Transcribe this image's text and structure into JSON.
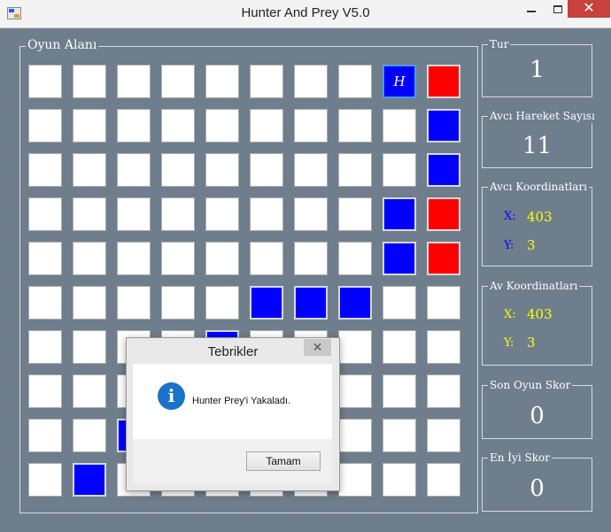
{
  "window": {
    "title": "Hunter And Prey V5.0",
    "close_glyph": "✕"
  },
  "board": {
    "label": "Oyun Alanı",
    "rows": [
      [
        "white",
        "white",
        "white",
        "white",
        "white",
        "white",
        "white",
        "white",
        "hunter",
        "red"
      ],
      [
        "white",
        "white",
        "white",
        "white",
        "white",
        "white",
        "white",
        "white",
        "white",
        "blue"
      ],
      [
        "white",
        "white",
        "white",
        "white",
        "white",
        "white",
        "white",
        "white",
        "white",
        "blue"
      ],
      [
        "white",
        "white",
        "white",
        "white",
        "white",
        "white",
        "white",
        "white",
        "blue",
        "red"
      ],
      [
        "white",
        "white",
        "white",
        "white",
        "white",
        "white",
        "white",
        "white",
        "blue",
        "red"
      ],
      [
        "white",
        "white",
        "white",
        "white",
        "white",
        "blue",
        "blue",
        "blue",
        "white",
        "white"
      ],
      [
        "white",
        "white",
        "white",
        "white",
        "blue",
        "white",
        "white",
        "white",
        "white",
        "white"
      ],
      [
        "white",
        "white",
        "white",
        "white",
        "white",
        "white",
        "white",
        "white",
        "white",
        "white"
      ],
      [
        "white",
        "white",
        "blue",
        "white",
        "white",
        "white",
        "white",
        "white",
        "white",
        "white"
      ],
      [
        "white",
        "blue",
        "white",
        "white",
        "white",
        "white",
        "white",
        "white",
        "white",
        "white"
      ]
    ],
    "hunter_text": "H",
    "colors": {
      "blue": "#0000ff",
      "red": "#ff0000",
      "white": "#ffffff",
      "background": "#6f7e8c"
    }
  },
  "panels": {
    "tur": {
      "label": "Tur",
      "value": "1"
    },
    "avci_hareket": {
      "label": "Avcı Hareket Sayısı",
      "value": "11"
    },
    "avci_koord": {
      "label": "Avcı Koordinatları",
      "x_label": "X:",
      "x_value": "403",
      "y_label": "Y:",
      "y_value": "3",
      "label_color": "#0000ff"
    },
    "av_koord": {
      "label": "Av Koordinatları",
      "x_label": "X:",
      "x_value": "403",
      "y_label": "Y:",
      "y_value": "3",
      "label_color": "#ffff00"
    },
    "son_oyun": {
      "label": "Son Oyun Skor",
      "value": "0"
    },
    "en_iyi": {
      "label": "En İyi Skor",
      "value": "0"
    }
  },
  "dialog": {
    "title": "Tebrikler",
    "close_glyph": "✕",
    "icon": "info-icon",
    "icon_glyph": "i",
    "message": "Hunter Prey'i Yakaladı.",
    "ok_label": "Tamam"
  }
}
